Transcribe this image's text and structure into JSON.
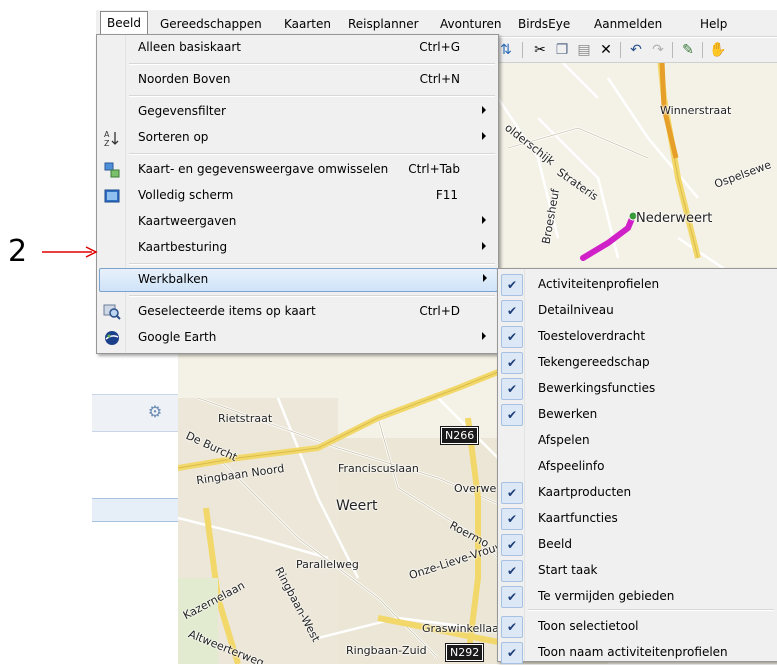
{
  "menubar": {
    "items": [
      "Beeld",
      "Gereedschappen",
      "Kaarten",
      "Reisplanner",
      "Avonturen",
      "BirdsEye",
      "Aanmelden",
      "Help"
    ]
  },
  "menu": {
    "items": [
      {
        "label": "Alleen basiskaart",
        "shortcut": "Ctrl+G",
        "icon": "",
        "submenu": false
      },
      {
        "label": "Noorden Boven",
        "shortcut": "Ctrl+N",
        "icon": "",
        "submenu": false
      },
      {
        "label": "Gegevensfilter",
        "shortcut": "",
        "icon": "",
        "submenu": true
      },
      {
        "label": "Sorteren op",
        "shortcut": "",
        "icon": "sort-az-icon",
        "submenu": true
      },
      {
        "label": "Kaart- en gegevensweergave omwisselen",
        "shortcut": "Ctrl+Tab",
        "icon": "swap-view-icon",
        "submenu": false
      },
      {
        "label": "Volledig scherm",
        "shortcut": "F11",
        "icon": "fullscreen-icon",
        "submenu": false
      },
      {
        "label": "Kaartweergaven",
        "shortcut": "",
        "icon": "",
        "submenu": true
      },
      {
        "label": "Kaartbesturing",
        "shortcut": "",
        "icon": "",
        "submenu": true
      },
      {
        "label": "Werkbalken",
        "shortcut": "",
        "icon": "",
        "submenu": true,
        "highlighted": true
      },
      {
        "label": "Geselecteerde items op kaart",
        "shortcut": "Ctrl+D",
        "icon": "magnifier-map-icon",
        "submenu": false
      },
      {
        "label": "Google Earth",
        "shortcut": "",
        "icon": "google-earth-icon",
        "submenu": true
      }
    ]
  },
  "submenu": {
    "items": [
      {
        "label": "Activiteitenprofielen",
        "checked": true
      },
      {
        "label": "Detailniveau",
        "checked": true
      },
      {
        "label": "Toesteloverdracht",
        "checked": true
      },
      {
        "label": "Tekengereedschap",
        "checked": true
      },
      {
        "label": "Bewerkingsfuncties",
        "checked": true
      },
      {
        "label": "Bewerken",
        "checked": true
      },
      {
        "label": "Afspelen",
        "checked": false
      },
      {
        "label": "Afspeelinfo",
        "checked": false
      },
      {
        "label": "Kaartproducten",
        "checked": true
      },
      {
        "label": "Kaartfuncties",
        "checked": true
      },
      {
        "label": "Beeld",
        "checked": true
      },
      {
        "label": "Start taak",
        "checked": true
      },
      {
        "label": "Te vermijden gebieden",
        "checked": true
      },
      {
        "label": "Toon selectietool",
        "checked": true
      },
      {
        "label": "Toon naam activiteitenprofielen",
        "checked": true
      }
    ]
  },
  "callout": {
    "number": "2",
    "color": "#e00000"
  },
  "map": {
    "labels": {
      "winnerstraat": "Winnerstraat",
      "oldersdijk": "olderschijk",
      "strateris": "Strateris",
      "ospelseweg": "Ospelsewe",
      "nederweert": "Nederweert",
      "broesheuf": "Broesheuf",
      "rietstraat": "Rietstraat",
      "deburcht": "De Burcht",
      "ringbaannoord": "Ringbaan Noord",
      "franciscuslaan": "Franciscuslaan",
      "weert": "Weert",
      "overweg": "Overwe",
      "parallelweg": "Parallelweg",
      "kazernelaan": "Kazernelaan",
      "graswinkellaan": "Graswinkellaan",
      "ringbaanzuid": "Ringbaan-Zuid",
      "altweerterweg": "Altweerterweg",
      "ringbaanwest": "Ringbaan-West",
      "roermond": "Roermo",
      "onzelieve": "Onze-Lieve-Vrouwestraat"
    },
    "shields": {
      "n266": "N266",
      "n292": "N292"
    },
    "route_color": "#d020c8"
  }
}
